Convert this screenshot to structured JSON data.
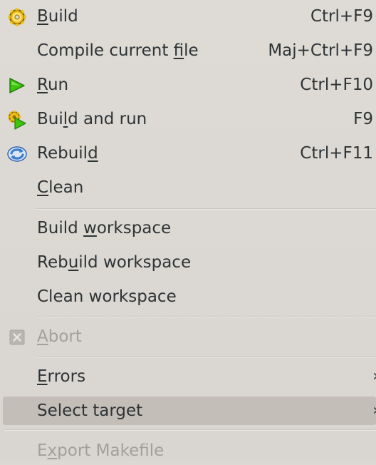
{
  "menu": {
    "items": [
      {
        "pre": "",
        "u": "B",
        "post": "uild",
        "shortcut": "Ctrl+F9",
        "icon": "gear-icon",
        "enabled": true
      },
      {
        "pre": "Compile current ",
        "u": "f",
        "post": "ile",
        "shortcut": "Maj+Ctrl+F9",
        "icon": "",
        "enabled": true
      },
      {
        "pre": "",
        "u": "R",
        "post": "un",
        "shortcut": "Ctrl+F10",
        "icon": "play-icon",
        "enabled": true
      },
      {
        "pre": "Bui",
        "u": "l",
        "post": "d and run",
        "shortcut": "F9",
        "icon": "build-and-run-icon",
        "enabled": true
      },
      {
        "pre": "Rebuil",
        "u": "d",
        "post": "",
        "shortcut": "Ctrl+F11",
        "icon": "rebuild-icon",
        "enabled": true
      },
      {
        "pre": "",
        "u": "C",
        "post": "lean",
        "shortcut": "",
        "icon": "",
        "enabled": true
      },
      {
        "pre": "Build ",
        "u": "w",
        "post": "orkspace",
        "shortcut": "",
        "icon": "",
        "enabled": true
      },
      {
        "pre": "Reb",
        "u": "u",
        "post": "ild workspace",
        "shortcut": "",
        "icon": "",
        "enabled": true
      },
      {
        "pre": "Clean workspace",
        "u": "",
        "post": "",
        "shortcut": "",
        "icon": "",
        "enabled": true
      },
      {
        "pre": "",
        "u": "A",
        "post": "bort",
        "shortcut": "",
        "icon": "abort-icon",
        "enabled": false
      },
      {
        "pre": "",
        "u": "E",
        "post": "rrors",
        "shortcut": "",
        "icon": "",
        "enabled": true,
        "submenu": "›"
      },
      {
        "pre": "Select target",
        "u": "",
        "post": "",
        "shortcut": "",
        "icon": "",
        "enabled": true,
        "submenu": "›",
        "highlighted": true
      },
      {
        "pre": "E",
        "u": "x",
        "post": "port Makefile",
        "shortcut": "",
        "icon": "",
        "enabled": false
      }
    ]
  },
  "colors": {
    "background": "#dcd8d3",
    "text": "#2e3436",
    "disabled_text": "#a39f9b",
    "highlight": "#c4beb9",
    "play_green": "#3cc40e",
    "rebuild_blue": "#3a7bd5",
    "gear_yellow": "#e8b400"
  }
}
